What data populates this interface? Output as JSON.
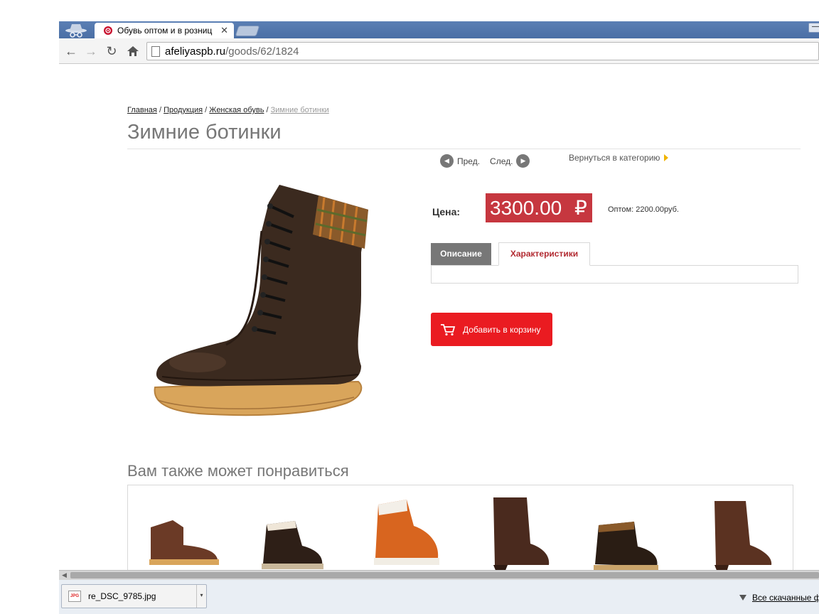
{
  "browser": {
    "tab_title": "Обувь оптом и в розниц",
    "url_host": "afeliyaspb.ru",
    "url_path": "/goods/62/1824"
  },
  "breadcrumb": {
    "home": "Главная",
    "products": "Продукция",
    "womens": "Женская обувь",
    "current": "Зимние ботинки",
    "sep": "/"
  },
  "product": {
    "title": "Зимние ботинки",
    "prev_label": "Пред.",
    "next_label": "След.",
    "back_label": "Вернуться в категорию",
    "price_label": "Цена:",
    "price_value": "3300.00",
    "currency": "₽",
    "wholesale": "Оптом: 2200.00руб.",
    "tab_description": "Описание",
    "tab_characteristics": "Характеристики",
    "add_to_cart": "Добавить в корзину"
  },
  "related": {
    "title": "Вам также может понравиться"
  },
  "download_bar": {
    "file_name": "re_DSC_9785.jpg",
    "file_badge": "JPG",
    "all_downloads": "Все скачанные ф"
  },
  "colors": {
    "tab_strip": "#4a6fa5",
    "price_bg": "#c6373f",
    "cart_bg": "#ea1b21",
    "tab_active_text": "#b22b32",
    "back_arrow": "#f0b400"
  }
}
